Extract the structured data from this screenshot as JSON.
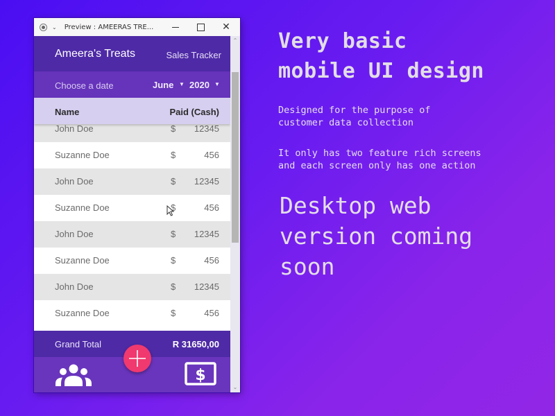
{
  "window": {
    "title": "Preview : AMEERAS TRE...",
    "icons": [
      "record-icon",
      "chevron-down-icon",
      "minimize-icon",
      "maximize-icon",
      "close-icon"
    ]
  },
  "app": {
    "title": "Ameera's Treats",
    "subtitle": "Sales Tracker",
    "date_picker": {
      "label": "Choose a date",
      "month": "June",
      "year": "2020"
    },
    "columns": {
      "name": "Name",
      "paid": "Paid (Cash)"
    },
    "rows": [
      {
        "name": "John Doe",
        "currency": "$",
        "amount": "12345"
      },
      {
        "name": "Suzanne Doe",
        "currency": "$",
        "amount": "456"
      },
      {
        "name": "John Doe",
        "currency": "$",
        "amount": "12345"
      },
      {
        "name": "Suzanne Doe",
        "currency": "$",
        "amount": "456"
      },
      {
        "name": "John Doe",
        "currency": "$",
        "amount": "12345"
      },
      {
        "name": "Suzanne Doe",
        "currency": "$",
        "amount": "456"
      },
      {
        "name": "John Doe",
        "currency": "$",
        "amount": "12345"
      },
      {
        "name": "Suzanne Doe",
        "currency": "$",
        "amount": "456"
      }
    ],
    "total": {
      "label": "Grand Total",
      "value": "R 31650,00"
    },
    "nav": {
      "customers_icon": "people-group-icon",
      "sales_icon": "dollar-bill-icon",
      "fab_icon": "plus-icon"
    },
    "colors": {
      "header": "#4e2aa6",
      "date_bar": "#6633bb",
      "column_header": "#d7cff0",
      "fab": "#f0396f"
    }
  },
  "promo": {
    "headline": "Very basic\nmobile UI design",
    "description_1": "Designed for the purpose of\ncustomer data collection",
    "description_2": "It only has two feature rich screens\nand each screen only has one action",
    "announcement": "Desktop web\nversion coming\nsoon"
  }
}
